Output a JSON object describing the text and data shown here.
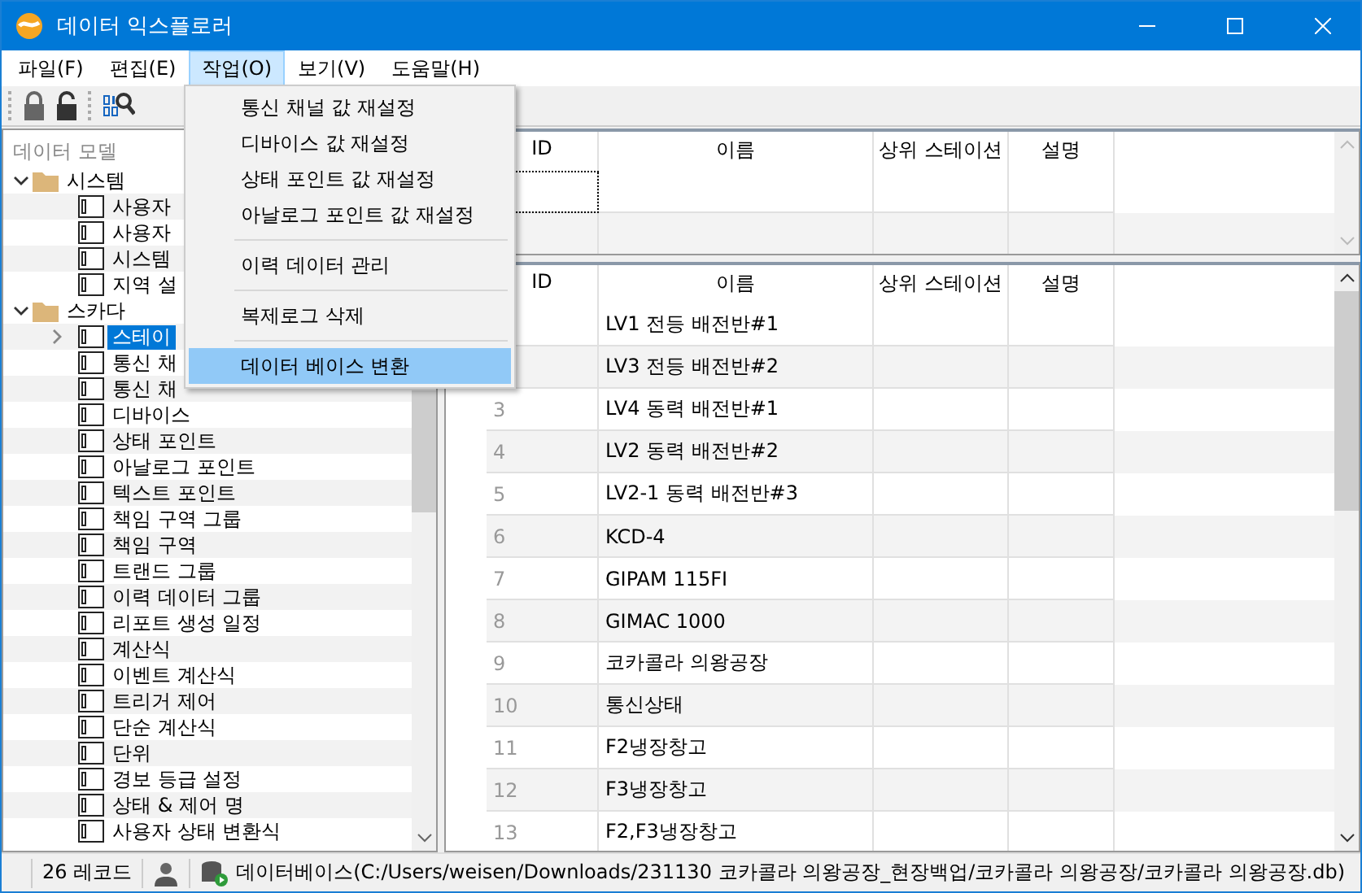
{
  "window": {
    "title": "데이터 익스플로러"
  },
  "menu_bar": [
    {
      "label": "파일(F)",
      "selected": false
    },
    {
      "label": "편집(E)",
      "selected": false
    },
    {
      "label": "작업(O)",
      "selected": true
    },
    {
      "label": "보기(V)",
      "selected": false
    },
    {
      "label": "도움말(H)",
      "selected": false
    }
  ],
  "open_menu": {
    "groups": [
      [
        {
          "label": "통신 채널 값 재설정",
          "selected": false
        },
        {
          "label": "디바이스 값 재설정",
          "selected": false
        },
        {
          "label": "상태 포인트 값 재설정",
          "selected": false
        },
        {
          "label": "아날로그 포인트 값 재설정",
          "selected": false
        }
      ],
      [
        {
          "label": "이력 데이터 관리",
          "selected": false
        }
      ],
      [
        {
          "label": "복제로그 삭제",
          "selected": false
        }
      ],
      [
        {
          "label": "데이터 베이스 변환",
          "selected": true
        }
      ]
    ]
  },
  "toolbar": [
    {
      "kind": "lock"
    },
    {
      "kind": "unlock"
    },
    {
      "kind": "binary-search"
    }
  ],
  "sidebar": {
    "title": "데이터 모델",
    "tree": [
      {
        "label": "시스템",
        "expanded": true,
        "selected": false,
        "children": [
          {
            "label": "사용자",
            "selected": false
          },
          {
            "label": "사용자",
            "selected": false
          },
          {
            "label": "시스템",
            "selected": false
          },
          {
            "label": "지역 설",
            "selected": false
          }
        ]
      },
      {
        "label": "스카다",
        "expanded": true,
        "selected": false,
        "children": [
          {
            "label": "스테이",
            "selected": true,
            "expanded": false
          },
          {
            "label": "통신 채",
            "selected": false
          },
          {
            "label": "통신 채",
            "selected": false
          },
          {
            "label": "디바이스",
            "selected": false
          },
          {
            "label": "상태 포인트",
            "selected": false
          },
          {
            "label": "아날로그 포인트",
            "selected": false
          },
          {
            "label": "텍스트 포인트",
            "selected": false
          },
          {
            "label": "책임 구역 그룹",
            "selected": false
          },
          {
            "label": "책임 구역",
            "selected": false
          },
          {
            "label": "트랜드 그룹",
            "selected": false
          },
          {
            "label": "이력 데이터 그룹",
            "selected": false
          },
          {
            "label": "리포트 생성 일정",
            "selected": false
          },
          {
            "label": "계산식",
            "selected": false
          },
          {
            "label": "이벤트 계산식",
            "selected": false
          },
          {
            "label": "트리거 제어",
            "selected": false
          },
          {
            "label": "단순 계산식",
            "selected": false
          },
          {
            "label": "단위",
            "selected": false
          },
          {
            "label": "경보 등급 설정",
            "selected": false
          },
          {
            "label": "상태 & 제어 명",
            "selected": false
          },
          {
            "label": "사용자 상태 변환식",
            "selected": false
          }
        ]
      }
    ]
  },
  "edit_table": {
    "columns": [
      "ID",
      "이름",
      "상위 스테이션",
      "설명"
    ]
  },
  "table": {
    "columns": [
      "ID",
      "이름",
      "상위 스테이션",
      "설명"
    ],
    "rows": [
      {
        "name": "LV1 전등 배전반#1"
      },
      {
        "name": "LV3 전등 배전반#2"
      },
      {
        "id": "3",
        "name": "LV4 동력 배전반#1"
      },
      {
        "id": "4",
        "name": "LV2 동력 배전반#2"
      },
      {
        "id": "5",
        "name": "LV2-1 동력 배전반#3"
      },
      {
        "id": "6",
        "name": "KCD-4"
      },
      {
        "id": "7",
        "name": "GIPAM 115FI"
      },
      {
        "id": "8",
        "name": "GIMAC 1000"
      },
      {
        "id": "9",
        "name": "코카콜라 의왕공장"
      },
      {
        "id": "10",
        "name": "통신상태"
      },
      {
        "id": "11",
        "name": "F2냉장창고"
      },
      {
        "id": "12",
        "name": "F3냉장창고"
      },
      {
        "id": "13",
        "name": "F2,F3냉장창고"
      }
    ]
  },
  "status_bar": {
    "records": "26 레코드",
    "database": "데이터베이스(C:/Users/weisen/Downloads/231130 코카콜라 의왕공장_현장백업/코카콜라 의왕공장/코카콜라 의왕공장.db)"
  }
}
